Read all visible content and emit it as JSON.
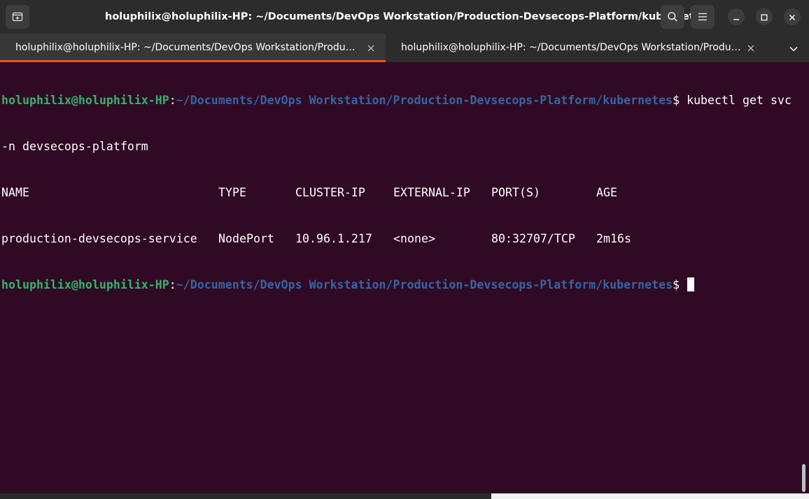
{
  "window": {
    "title": "holuphilix@holuphilix-HP: ~/Documents/DevOps Workstation/Production-Devsecops-Platform/kubernetes"
  },
  "header": {
    "new_tab_icon": "new-tab-icon",
    "search_icon": "search-icon",
    "menu_icon": "hamburger-menu-icon",
    "minimize_icon": "minimize-icon",
    "maximize_icon": "maximize-icon",
    "close_icon": "close-icon"
  },
  "tabs": [
    {
      "label": "holuphilix@holuphilix-HP: ~/Documents/DevOps Workstation/Production-Devsecops-Platform/kubernetes",
      "active": true
    },
    {
      "label": "holuphilix@holuphilix-HP: ~/Documents/DevOps Workstation/Production-Devsecops-Platform/kubernetes",
      "active": false
    }
  ],
  "terminal": {
    "prompt_user": "holuphilix@holuphilix-HP",
    "prompt_colon": ":",
    "prompt_path": "~/Documents/DevOps Workstation/Production-Devsecops-Platform/kubernetes",
    "prompt_symbol": "$ ",
    "command_part1": "kubectl get svc",
    "command_part2": "-n devsecops-platform",
    "table": {
      "headers": [
        "NAME",
        "TYPE",
        "CLUSTER-IP",
        "EXTERNAL-IP",
        "PORT(S)",
        "AGE"
      ],
      "rows": [
        [
          "production-devsecops-service",
          "NodePort",
          "10.96.1.217",
          "<none>",
          "80:32707/TCP",
          "2m16s"
        ]
      ]
    }
  },
  "colors": {
    "terminal_bg": "#300a24",
    "prompt_user": "#33b36e",
    "prompt_path": "#3465a4",
    "tab_accent": "#e95420",
    "header_bg": "#2c2c2c"
  }
}
